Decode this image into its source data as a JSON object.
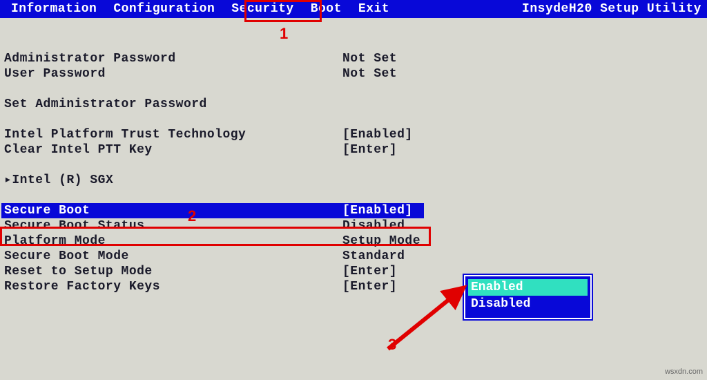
{
  "menubar": {
    "items": [
      "Information",
      "Configuration",
      "Security",
      "Boot",
      "Exit"
    ],
    "title": "InsydeH20 Setup Utility"
  },
  "rows": {
    "admin_pw_label": "Administrator Password",
    "admin_pw_value": "Not Set",
    "user_pw_label": "User Password",
    "user_pw_value": "Not Set",
    "set_admin_label": "Set Administrator Password",
    "ipt_label": "Intel Platform Trust Technology",
    "ipt_value": "[Enabled]",
    "clear_ptt_label": "Clear Intel PTT Key",
    "clear_ptt_value": "[Enter]",
    "sgx_label": "▸Intel (R) SGX",
    "secure_boot_label": "Secure Boot",
    "secure_boot_value": "[Enabled]",
    "sb_status_label": "Secure Boot Status",
    "sb_status_value": "Disabled",
    "platform_mode_label": "Platform Mode",
    "platform_mode_value": "Setup Mode",
    "sb_mode_label": "Secure Boot Mode",
    "sb_mode_value": "Standard",
    "reset_setup_label": "Reset to Setup Mode",
    "reset_setup_value": "[Enter]",
    "restore_keys_label": "Restore Factory Keys",
    "restore_keys_value": "[Enter]"
  },
  "popup": {
    "options": [
      "Enabled",
      "Disabled"
    ],
    "selected": "Enabled"
  },
  "annotations": {
    "n1": "1",
    "n2": "2",
    "n3": "3"
  },
  "watermark": "wsxdn.com"
}
